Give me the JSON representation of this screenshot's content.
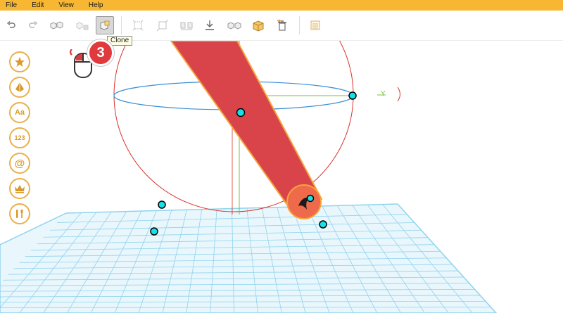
{
  "menu": {
    "items": [
      "File",
      "Edit",
      "View",
      "Help"
    ]
  },
  "toolbar": {
    "buttons": [
      "undo-icon",
      "redo-icon",
      "group-icon",
      "ungroup-icon",
      "clone-icon",
      "align-icon",
      "scale-icon",
      "mirror-icon",
      "drop-to-floor-icon",
      "split-icon",
      "merge-icon",
      "remove-icon",
      "settings-icon"
    ],
    "active": "clone-icon",
    "tooltip": "Clone"
  },
  "sidebar": {
    "items": [
      {
        "name": "star-icon",
        "label": ""
      },
      {
        "name": "shape-icon",
        "label": ""
      },
      {
        "name": "text",
        "label": "Aa"
      },
      {
        "name": "numbers",
        "label": "123"
      },
      {
        "name": "at-icon",
        "label": "@"
      },
      {
        "name": "crown-icon",
        "label": ""
      },
      {
        "name": "tools-icon",
        "label": ""
      }
    ]
  },
  "tutorial": {
    "step": "3"
  },
  "viewport": {
    "axis_label": "Y"
  },
  "colors": {
    "menubar": "#f7b733",
    "accent": "#e8b04a",
    "object_fill": "#d9444b",
    "object_outline": "#f5a53c",
    "grid": "#8fd3ee",
    "gizmo_red": "#d9332b",
    "gizmo_blue": "#3a8fd6",
    "gizmo_green": "#7fbf3f",
    "handle": "#19e0e8",
    "badge": "#e0393e"
  }
}
